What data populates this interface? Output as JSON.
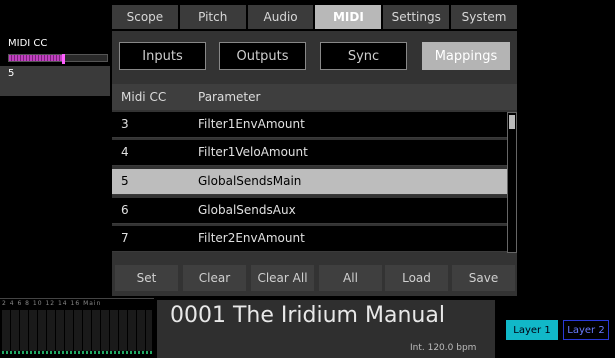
{
  "sidebar": {
    "cc_label": "MIDI CC",
    "cc_value": "5",
    "meter_level": 0.55
  },
  "tabs": [
    {
      "label": "Scope",
      "active": false
    },
    {
      "label": "Pitch",
      "active": false
    },
    {
      "label": "Audio",
      "active": false
    },
    {
      "label": "MIDI",
      "active": true
    },
    {
      "label": "Settings",
      "active": false
    },
    {
      "label": "System",
      "active": false
    }
  ],
  "subtabs": [
    {
      "label": "Inputs",
      "active": false
    },
    {
      "label": "Outputs",
      "active": false
    },
    {
      "label": "Sync",
      "active": false
    },
    {
      "label": "Mappings",
      "active": true
    }
  ],
  "table": {
    "headers": {
      "cc": "Midi CC",
      "param": "Parameter"
    },
    "rows": [
      {
        "cc": "3",
        "param": "Filter1EnvAmount",
        "selected": false
      },
      {
        "cc": "4",
        "param": "Filter1VeloAmount",
        "selected": false
      },
      {
        "cc": "5",
        "param": "GlobalSendsMain",
        "selected": true
      },
      {
        "cc": "6",
        "param": "GlobalSendsAux",
        "selected": false
      },
      {
        "cc": "7",
        "param": "Filter2EnvAmount",
        "selected": false
      }
    ]
  },
  "buttons": {
    "set": "Set",
    "clear": "Clear",
    "clear_all": "Clear All",
    "all": "All",
    "load": "Load",
    "save": "Save"
  },
  "footer": {
    "vu_labels": "2 4 6 8 10 12 14 16 Main",
    "preset_name": "0001 The Iridium Manual",
    "tempo": "Int. 120.0 bpm",
    "layer1": "Layer 1",
    "layer2": "Layer 2"
  },
  "colors": {
    "accent_active_tab": "#b8b8b8",
    "layer1": "#11b8c8",
    "layer2_border": "#2a3ad8",
    "meter": "#c040c0"
  }
}
